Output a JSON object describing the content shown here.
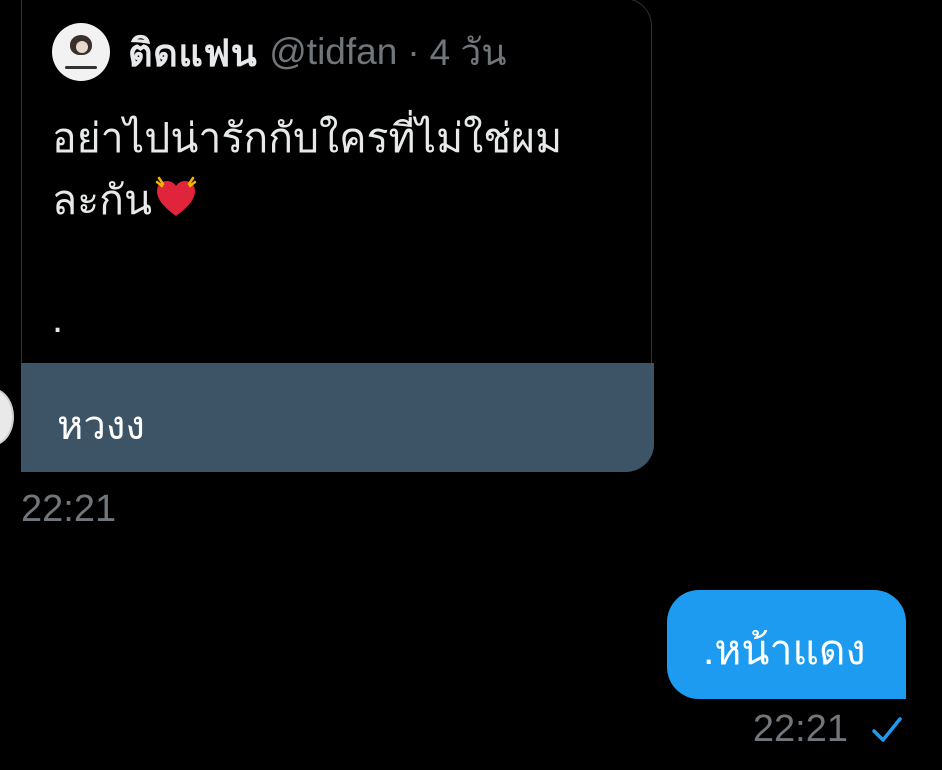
{
  "tweet": {
    "display_name": "ติดแฟน",
    "handle": "@tidfan",
    "separator": "·",
    "age": "4 วัน",
    "body_line1": "อย่าไปน่ารักกับใครที่ไม่ใช่ผม",
    "body_line2": "ละกัน",
    "emoji": "heart-with-sparkles-icon",
    "trailing": "."
  },
  "received_message": {
    "text": "หวงง",
    "time": "22:21"
  },
  "sent_message": {
    "text": ".หน้าแดง",
    "time": "22:21",
    "status_icon": "sent-check-icon"
  },
  "colors": {
    "background": "#000000",
    "received_bubble": "#3d5466",
    "sent_bubble": "#1d9bf0",
    "muted_text": "#71767b",
    "check": "#1d9bf0"
  }
}
